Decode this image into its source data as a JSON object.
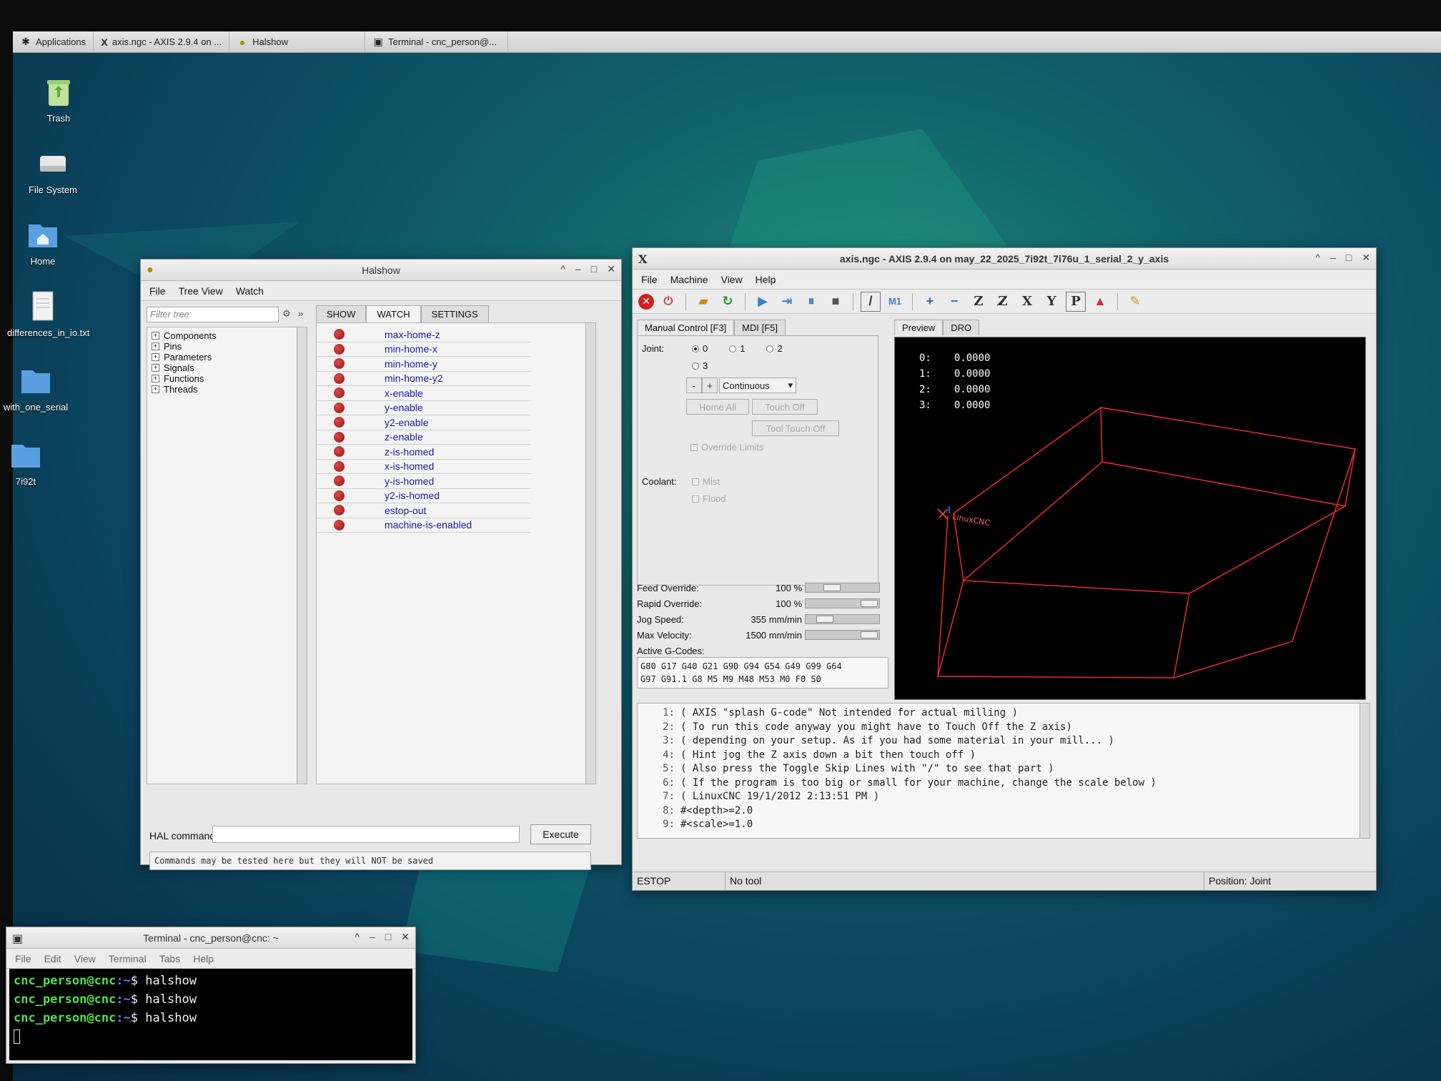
{
  "taskbar": {
    "items": [
      {
        "icon": "applications-icon",
        "label": "Applications"
      },
      {
        "icon": "x-window-icon",
        "label": "axis.ngc - AXIS 2.9.4 on ..."
      },
      {
        "icon": "halshow-window-icon",
        "label": "Halshow"
      },
      {
        "icon": "terminal-icon",
        "label": "Terminal - cnc_person@..."
      }
    ]
  },
  "desktop": {
    "icons": [
      {
        "name": "trash",
        "label": "Trash"
      },
      {
        "name": "file-system",
        "label": "File System"
      },
      {
        "name": "home",
        "label": "Home"
      },
      {
        "name": "text-file",
        "label": "differences_in_io.txt"
      },
      {
        "name": "folder",
        "label": "with_one_serial"
      },
      {
        "name": "folder",
        "label": "7i92t"
      }
    ]
  },
  "halshow": {
    "title": "Halshow",
    "menu": [
      "File",
      "Tree View",
      "Watch"
    ],
    "filter_placeholder": "Filter tree",
    "filter_more": "»",
    "tree": [
      "Components",
      "Pins",
      "Parameters",
      "Signals",
      "Functions",
      "Threads"
    ],
    "tabs": [
      "SHOW",
      "WATCH",
      "SETTINGS"
    ],
    "active_tab": "WATCH",
    "watch": [
      "max-home-z",
      "min-home-x",
      "min-home-y",
      "min-home-y2",
      "x-enable",
      "y-enable",
      "y2-enable",
      "z-enable",
      "z-is-homed",
      "x-is-homed",
      "y-is-homed",
      "y2-is-homed",
      "estop-out",
      "machine-is-enabled"
    ],
    "led_color": "#9b1414",
    "hal_command_label": "HAL command :",
    "execute_label": "Execute",
    "note": "Commands may be tested here but they will NOT be saved"
  },
  "axis": {
    "title": "axis.ngc - AXIS 2.9.4 on may_22_2025_7i92t_7i76u_1_serial_2_y_axis",
    "title_icon": "X",
    "menu": [
      "File",
      "Machine",
      "View",
      "Help"
    ],
    "toolbar_axes": [
      "Z",
      "X",
      "Y",
      "P"
    ],
    "tabs": [
      "Manual Control [F3]",
      "MDI [F5]"
    ],
    "joint_label": "Joint:",
    "joints": [
      "0",
      "1",
      "2",
      "3"
    ],
    "selected_joint": "0",
    "jog_minus": "-",
    "jog_plus": "+",
    "jog_mode": "Continuous",
    "home_all": "Home All",
    "touch_off": "Touch Off",
    "tool_touch_off": "Tool Touch Off",
    "override_limits": "Override Limits",
    "coolant_label": "Coolant:",
    "mist": "Mist",
    "flood": "Flood",
    "feed_override": {
      "label": "Feed Override:",
      "value": "100",
      "unit": "%",
      "fraction": 0.33
    },
    "rapid_override": {
      "label": "Rapid Override:",
      "value": "100",
      "unit": "%",
      "fraction": 1.0
    },
    "jog_speed": {
      "label": "Jog Speed:",
      "value": "355",
      "unit": "mm/min",
      "fraction": 0.2
    },
    "max_velocity": {
      "label": "Max Velocity:",
      "value": "1500",
      "unit": "mm/min",
      "fraction": 1.0
    },
    "active_gcodes_label": "Active G-Codes:",
    "active_gcodes": [
      "G80 G17 G40 G21 G90 G94 G54 G49 G99 G64",
      "G97 G91.1 G8 M5 M9 M48 M53 M0 F0 S0"
    ],
    "preview_tabs": [
      "Preview",
      "DRO"
    ],
    "dro": [
      {
        "joint": "0:",
        "value": "0.0000"
      },
      {
        "joint": "1:",
        "value": "0.0000"
      },
      {
        "joint": "2:",
        "value": "0.0000"
      },
      {
        "joint": "3:",
        "value": "0.0000"
      }
    ],
    "preview_logo": "LinuxCNC",
    "code": [
      {
        "n": "1:",
        "text": "( AXIS \"splash G-code\" Not intended for actual milling )"
      },
      {
        "n": "2:",
        "text": "( To run this code anyway you might have to Touch Off the Z axis)"
      },
      {
        "n": "3:",
        "text": "( depending on your setup. As if you had some material in your mill... )"
      },
      {
        "n": "4:",
        "text": "( Hint jog the Z axis down a bit then touch off )"
      },
      {
        "n": "5:",
        "text": "( Also press the Toggle Skip Lines with \"/\" to see that part )"
      },
      {
        "n": "6:",
        "text": "( If the program is too big or small for your machine, change the scale below )"
      },
      {
        "n": "7:",
        "text": "( LinuxCNC 19/1/2012 2:13:51 PM )"
      },
      {
        "n": "8:",
        "text": "#<depth>=2.0"
      },
      {
        "n": "9:",
        "text": "#<scale>=1.0"
      }
    ],
    "status": {
      "state": "ESTOP",
      "tool": "No tool",
      "position": "Position: Joint"
    }
  },
  "terminal": {
    "title": "Terminal - cnc_person@cnc: ~",
    "menu": [
      "File",
      "Edit",
      "View",
      "Terminal",
      "Tabs",
      "Help"
    ],
    "lines": [
      {
        "user": "cnc_person@cnc",
        "path": ":~",
        "prompt": "$",
        "cmd": "halshow"
      },
      {
        "user": "cnc_person@cnc",
        "path": ":~",
        "prompt": "$",
        "cmd": "halshow"
      },
      {
        "user": "cnc_person@cnc",
        "path": ":~",
        "prompt": "$",
        "cmd": "halshow"
      }
    ]
  }
}
